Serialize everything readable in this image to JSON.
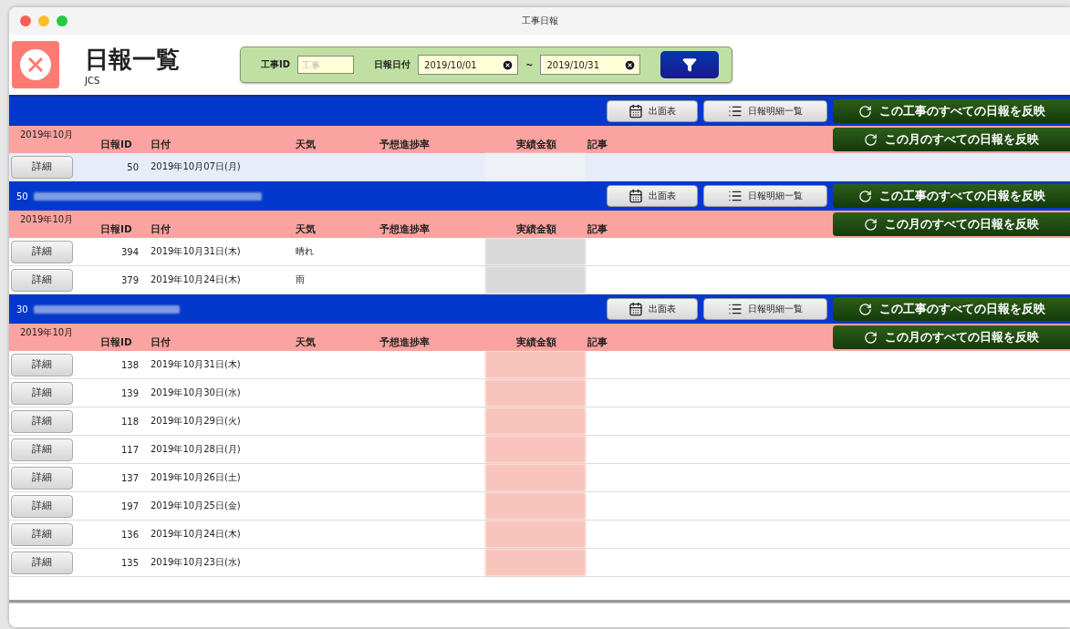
{
  "window": {
    "title": "工事日報"
  },
  "header": {
    "title": "日報一覧",
    "subtitle": "JCS"
  },
  "filter": {
    "project_label": "工事ID",
    "project_placeholder": "工事",
    "date_label": "日報日付",
    "date_from": "2019/10/01",
    "separator": "~",
    "date_to": "2019/10/31"
  },
  "sections": [
    {
      "buttons": [
        "出面表",
        "日報明細一覧",
        "この工事のすべての日報を反映"
      ],
      "month": "2019年10月",
      "month_button": "この月のすべての日報を反映",
      "columns": [
        "日報ID",
        "日付",
        "天気",
        "予想進捗率",
        "実績金額",
        "記事"
      ],
      "rows": [
        {
          "detail": "詳細",
          "id": "50",
          "date": "2019年10月07日(月)",
          "selected": true
        }
      ]
    },
    {
      "title": "50",
      "buttons": [
        "出面表",
        "日報明細一覧",
        "この工事のすべての日報を反映"
      ],
      "month": "2019年10月",
      "month_button": "この月のすべての日報を反映",
      "columns": [
        "日報ID",
        "日付",
        "天気",
        "予想進捗率",
        "実績金額",
        "記事"
      ],
      "rows": [
        {
          "detail": "詳細",
          "id": "394",
          "date": "2019年10月31日(木)",
          "weather": "晴れ",
          "selected": false
        },
        {
          "detail": "詳細",
          "id": "379",
          "date": "2019年10月24日(木)",
          "weather": "雨",
          "selected": false
        }
      ]
    },
    {
      "title": "30",
      "buttons": [
        "出面表",
        "日報明細一覧",
        "この工事のすべての日報を反映"
      ],
      "month": "2019年10月",
      "month_button": "この月のすべての日報を反映",
      "columns": [
        "日報ID",
        "日付",
        "天気",
        "予想進捗率",
        "実績金額",
        "記事"
      ],
      "rows": [
        {
          "detail": "詳細",
          "id": "138",
          "date": "2019年10月31日(木)",
          "selected": false
        },
        {
          "detail": "詳細",
          "id": "139",
          "date": "2019年10月30日(水)",
          "selected": false
        },
        {
          "detail": "詳細",
          "id": "118",
          "date": "2019年10月29日(火)",
          "selected": false
        },
        {
          "detail": "詳細",
          "id": "117",
          "date": "2019年10月28日(月)",
          "selected": false
        },
        {
          "detail": "詳細",
          "id": "137",
          "date": "2019年10月26日(土)",
          "selected": false
        },
        {
          "detail": "詳細",
          "id": "197",
          "date": "2019年10月25日(金)",
          "selected": false
        },
        {
          "detail": "詳細",
          "id": "136",
          "date": "2019年10月24日(木)",
          "selected": false
        },
        {
          "detail": "詳細",
          "id": "135",
          "date": "2019年10月23日(水)",
          "selected": false
        }
      ]
    }
  ]
}
